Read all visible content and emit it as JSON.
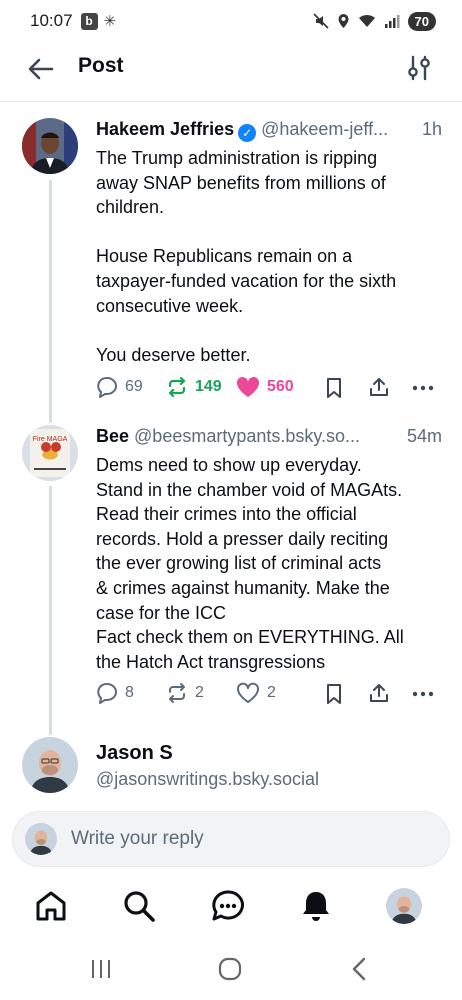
{
  "status_bar": {
    "time": "10:07",
    "b_badge": "b",
    "battery": "70"
  },
  "header": {
    "title": "Post"
  },
  "posts": [
    {
      "author": "Hakeem Jeffries",
      "verified": true,
      "handle": "@hakeem-jeff...",
      "time": "1h",
      "paragraphs": [
        [
          "The Trump administration is ripping",
          "away SNAP benefits from millions of",
          "children."
        ],
        [
          "House Republicans remain on a",
          "taxpayer-funded vacation for the sixth",
          "consecutive week."
        ],
        [
          "You deserve better."
        ]
      ],
      "replies": "69",
      "reposts": "149",
      "likes": "560"
    },
    {
      "author": "Bee",
      "handle": "@beesmartypants.bsky.so...",
      "time": "54m",
      "lines": [
        "Dems need to show up everyday.",
        "Stand in the chamber void of MAGAts.",
        "Read their crimes into the official",
        "records. Hold a presser daily reciting",
        "the ever growing list of criminal acts",
        "& crimes against humanity. Make the",
        "case for the ICC",
        "Fact check them on EVERYTHING. All",
        "the Hatch Act  transgressions"
      ],
      "replies": "8",
      "reposts": "2",
      "likes": "2",
      "avatar_text": "Fire MAGA"
    },
    {
      "author": "Jason S",
      "handle": "@jasonswritings.bsky.social"
    }
  ],
  "reply_box": {
    "placeholder": "Write your reply"
  },
  "colors": {
    "accent": "#1083fe",
    "repost_active": "#19a35a",
    "like_active": "#ec4899",
    "muted": "#5a6b7c"
  },
  "icons": {
    "nav": [
      "home-icon",
      "search-icon",
      "chat-icon",
      "notifications-icon",
      "profile-avatar"
    ],
    "system": [
      "recent-apps-icon",
      "home-circle-icon",
      "back-chevron-icon"
    ]
  }
}
